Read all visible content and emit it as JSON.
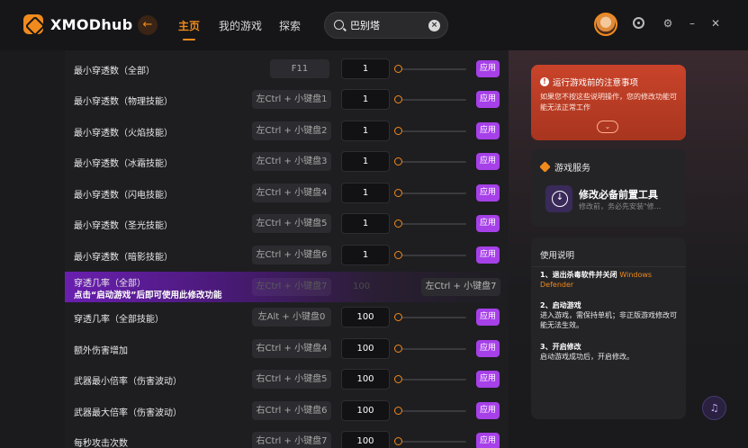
{
  "app": {
    "name": "XMODhub"
  },
  "nav": [
    {
      "label": "主页",
      "active": true
    },
    {
      "label": "我的游戏",
      "active": false
    },
    {
      "label": "探索",
      "active": false
    }
  ],
  "search": {
    "value": "巴别塔",
    "placeholder": ""
  },
  "colors": {
    "accent": "#f08a1c",
    "apply": "#a640e8",
    "warning": "#c9432a",
    "highlight": "#6a1fb0"
  },
  "rows": [
    {
      "label": "最小穿透数（全部）",
      "hotkey": "F11",
      "value": "1",
      "apply": "应用"
    },
    {
      "label": "最小穿透数（物理技能）",
      "hotkey": "左Ctrl + 小键盘1",
      "value": "1",
      "apply": "应用"
    },
    {
      "label": "最小穿透数（火焰技能）",
      "hotkey": "左Ctrl + 小键盘2",
      "value": "1",
      "apply": "应用"
    },
    {
      "label": "最小穿透数（冰霜技能）",
      "hotkey": "左Ctrl + 小键盘3",
      "value": "1",
      "apply": "应用"
    },
    {
      "label": "最小穿透数（闪电技能）",
      "hotkey": "左Ctrl + 小键盘4",
      "value": "1",
      "apply": "应用"
    },
    {
      "label": "最小穿透数（圣光技能）",
      "hotkey": "左Ctrl + 小键盘5",
      "value": "1",
      "apply": "应用"
    },
    {
      "label": "最小穿透数（暗影技能）",
      "hotkey": "左Ctrl + 小键盘6",
      "value": "1",
      "apply": "应用"
    }
  ],
  "highlight_row": {
    "label": "穿透几率（全部）",
    "note": "点击“启动游戏”后即可使用此修改功能",
    "ghost_hotkey": "左Ctrl + 小键盘7",
    "ghost_value": "100",
    "hotkey": "左Ctrl + 小键盘7"
  },
  "rows2": [
    {
      "label": "穿透几率（全部技能）",
      "hotkey": "左Alt + 小键盘0",
      "value": "100",
      "apply": "应用"
    },
    {
      "label": "额外伤害增加",
      "hotkey": "右Ctrl + 小键盘4",
      "value": "100",
      "apply": "应用"
    },
    {
      "label": "武器最小倍率（伤害波动）",
      "hotkey": "右Ctrl + 小键盘5",
      "value": "100",
      "apply": "应用"
    },
    {
      "label": "武器最大倍率（伤害波动）",
      "hotkey": "右Ctrl + 小键盘6",
      "value": "100",
      "apply": "应用"
    },
    {
      "label": "每秒攻击次数",
      "hotkey": "右Ctrl + 小键盘7",
      "value": "100",
      "apply": "应用"
    }
  ],
  "warning": {
    "title": "运行游戏前的注意事项",
    "body": "如果您不按这些说明操作，您的修改功能可能无法正常工作"
  },
  "service": {
    "title": "游戏服务",
    "tool_name": "修改必备前置工具",
    "tool_desc": "修改前，务必先安装\"修..."
  },
  "help": {
    "title": "使用说明",
    "s1_title": "1、退出杀毒软件并关闭",
    "s1_hl": "Windows Defender",
    "s2_title": "2、启动游戏",
    "s2_body": "进入游戏，需保持单机；非正版游戏修改可能无法生效。",
    "s3_title": "3、开启修改",
    "s3_body": "启动游戏成功后，开启修改。"
  }
}
